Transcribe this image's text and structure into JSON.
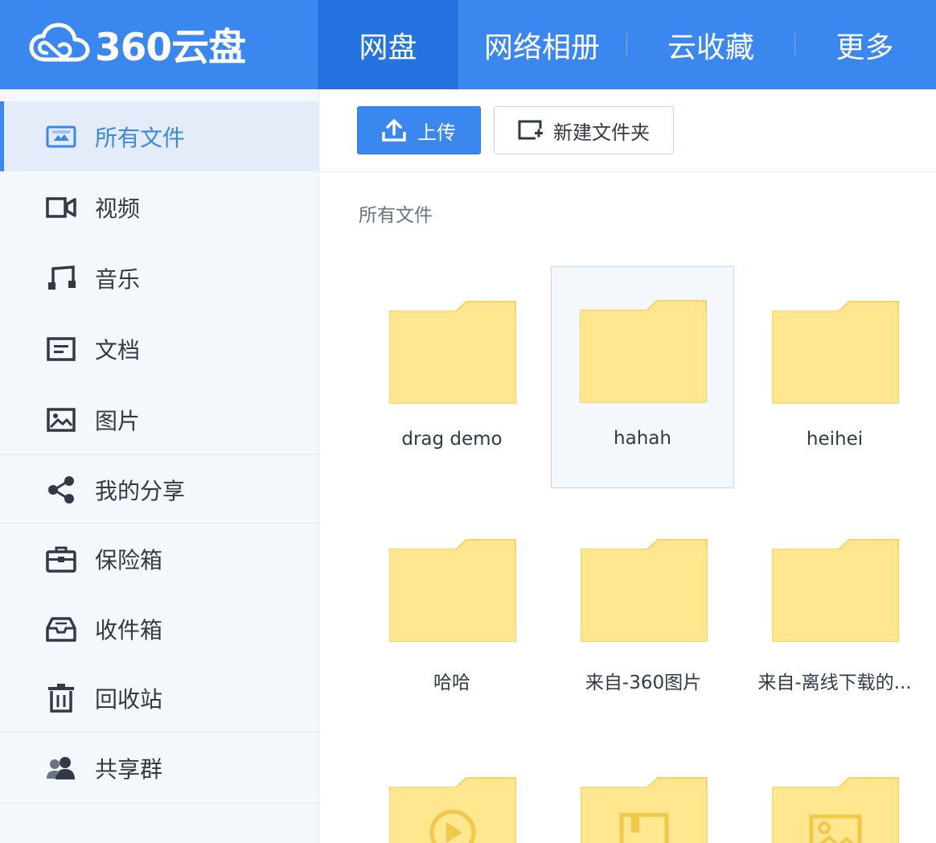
{
  "header": {
    "logo_text": "360云盘",
    "nav": [
      {
        "label": "网盘",
        "active": true
      },
      {
        "label": "网络相册",
        "active": false
      },
      {
        "label": "云收藏",
        "active": false
      },
      {
        "label": "更多",
        "active": false
      }
    ]
  },
  "sidebar": {
    "items": [
      {
        "label": "所有文件",
        "icon": "all-files-icon",
        "active": true
      },
      {
        "label": "视频",
        "icon": "video-icon"
      },
      {
        "label": "音乐",
        "icon": "music-icon"
      },
      {
        "label": "文档",
        "icon": "document-icon"
      },
      {
        "label": "图片",
        "icon": "image-icon"
      },
      {
        "label": "我的分享",
        "icon": "share-icon"
      },
      {
        "label": "保险箱",
        "icon": "safe-box-icon"
      },
      {
        "label": "收件箱",
        "icon": "inbox-icon"
      },
      {
        "label": "回收站",
        "icon": "trash-icon"
      },
      {
        "label": "共享群",
        "icon": "group-icon"
      }
    ]
  },
  "toolbar": {
    "upload_label": "上传",
    "new_folder_label": "新建文件夹"
  },
  "breadcrumb": "所有文件",
  "files": [
    {
      "name": "drag demo",
      "type": "folder"
    },
    {
      "name": "hahah",
      "type": "folder",
      "selected": true
    },
    {
      "name": "heihei",
      "type": "folder"
    },
    {
      "name": "哈哈",
      "type": "folder"
    },
    {
      "name": "来自-360图片",
      "type": "folder"
    },
    {
      "name": "来自-离线下载的...",
      "type": "folder"
    },
    {
      "name": "",
      "type": "video-folder"
    },
    {
      "name": "",
      "type": "document-folder"
    },
    {
      "name": "",
      "type": "image-folder"
    }
  ],
  "colors": {
    "brand": "#3b87f0",
    "folder": "#ffe58f",
    "folder_border": "#f5d36b"
  }
}
